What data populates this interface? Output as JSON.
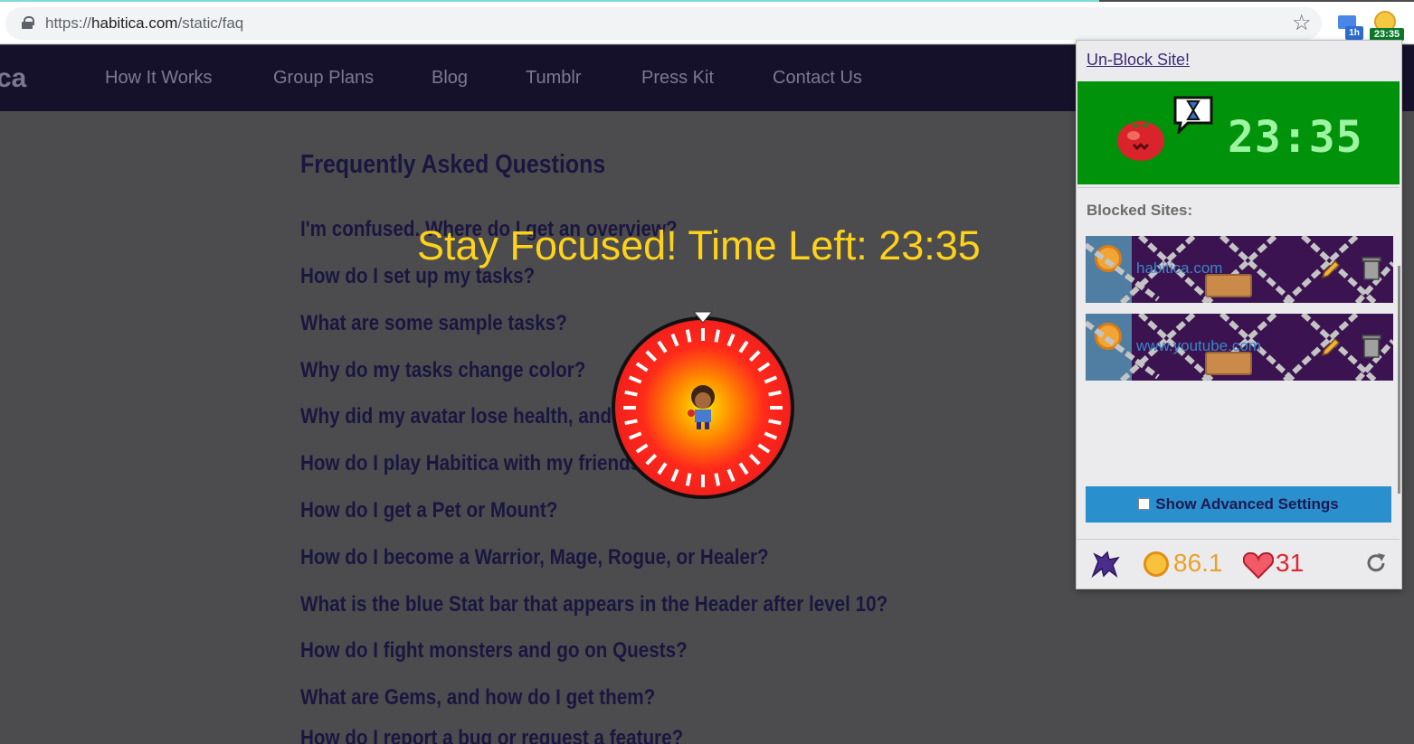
{
  "browser": {
    "url_scheme": "https://",
    "url_host": "habitica.com",
    "url_path": "/static/faq",
    "ext_chat_badge": "1h",
    "ext_timer_badge": "23:35"
  },
  "site": {
    "logo_fragment": "ca",
    "nav": [
      "How It Works",
      "Group Plans",
      "Blog",
      "Tumblr",
      "Press Kit",
      "Contact Us"
    ]
  },
  "faq": {
    "title": "Frequently Asked Questions",
    "questions": [
      "I'm confused. Where do I get an overview?",
      "How do I set up my tasks?",
      "What are some sample tasks?",
      "Why do my tasks change color?",
      "Why did my avatar lose health, and how do I regain it?",
      "How do I play Habitica with my friends?",
      "How do I get a Pet or Mount?",
      "How do I become a Warrior, Mage, Rogue, or Healer?",
      "What is the blue Stat bar that appears in the Header after level 10?",
      "How do I fight monsters and go on Quests?",
      "What are Gems, and how do I get them?",
      "How do I report a bug or request a feature?"
    ]
  },
  "overlay": {
    "message": "Stay Focused! Time Left: 23:35"
  },
  "popup": {
    "unblock_link": "Un-Block Site!",
    "timer": "23:35",
    "blocked_label": "Blocked Sites:",
    "blocked_sites": [
      "habitica.com",
      "www.youtube.com"
    ],
    "advanced_button": "Show Advanced Settings",
    "gold": "86.1",
    "health": "31"
  },
  "colors": {
    "nav_bg": "#16112a",
    "overlay_text": "#ffd21a",
    "timer_panel": "#00920a",
    "advanced_button": "#2a8fcd",
    "gold": "#e9a128",
    "health": "#e0262e"
  }
}
